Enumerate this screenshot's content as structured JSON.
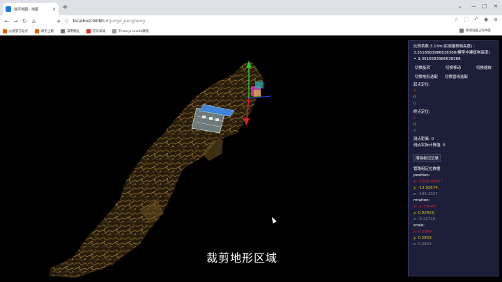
{
  "browser": {
    "tab_title": "首页地图 - 地图",
    "url_host": "localhost:8080",
    "url_path": "/#/judge_pengheng",
    "bookmarks": [
      "火狐官方站点",
      "新手上路",
      "常用网址",
      "京东商城",
      "Three.js Line3d教程",
      "移动设备上的书签"
    ]
  },
  "viewport": {
    "caption": "裁剪地形区域"
  },
  "panel": {
    "scale_line1": "比例系数:3.13m(实测建筑物高度) :",
    "scale_line2": "3.3516583986638368(模型中建筑物高度)",
    "scale_line3": "= 3.3516583986638368",
    "buttons_row1": [
      "切换旋转",
      "切换移动",
      "切换缩放"
    ],
    "buttons_row2": [
      "切换地形选取",
      "切换管线选取"
    ],
    "start_title": "起点定位:",
    "start_values": [
      "0",
      "0",
      "0"
    ],
    "end_title": "终点定位:",
    "end_values": [
      "0",
      "0",
      "0"
    ],
    "distance": "测点距离: 0",
    "actual_calc": "测点实际计算值: 0",
    "clear_button": "清除标记记录",
    "pipe_title": "管路组定位数据",
    "position_label": "position:",
    "position": {
      "x": "x: -1309.09877",
      "y": "y: -13.92674,",
      "z": "z: -194.2027"
    },
    "rotation_label": "rotation:",
    "rotation": {
      "x": "x: -1.73643,",
      "y": "y: 0.92419,",
      "z": "z: -0.22716"
    },
    "scale_label": "scale:",
    "scale": {
      "x": "x: 0.2859,",
      "y": "y: 0.2859,",
      "z": "z: 0.2859"
    }
  }
}
